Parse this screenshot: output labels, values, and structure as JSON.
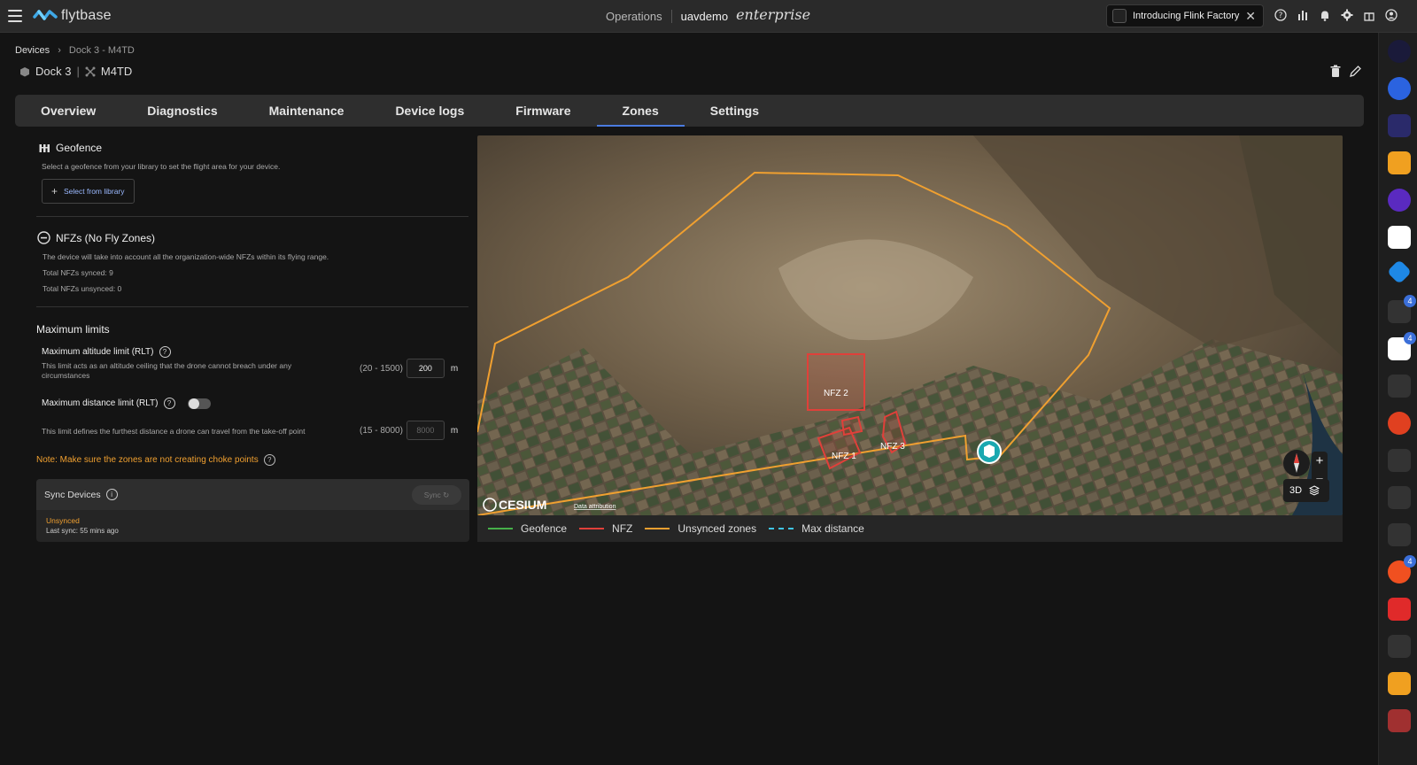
{
  "app": {
    "brand": "flytbase",
    "nav_operations": "Operations",
    "org": "uavdemo",
    "edition": "enterprise",
    "promo_text": "Introducing Flink Factory"
  },
  "breadcrumb": {
    "root": "Devices",
    "current": "Dock 3 - M4TD"
  },
  "device": {
    "dock": "Dock 3",
    "drone": "M4TD"
  },
  "tabs": [
    {
      "label": "Overview"
    },
    {
      "label": "Diagnostics"
    },
    {
      "label": "Maintenance"
    },
    {
      "label": "Device logs"
    },
    {
      "label": "Firmware"
    },
    {
      "label": "Zones",
      "active": true
    },
    {
      "label": "Settings"
    }
  ],
  "geofence": {
    "title": "Geofence",
    "desc": "Select a geofence from your library to set the flight area for your device.",
    "button": "Select from library"
  },
  "nfz": {
    "title": "NFZs (No Fly Zones)",
    "desc": "The device will take into account all the organization-wide NFZs within its flying range.",
    "synced": "Total NFZs synced: 9",
    "unsynced": "Total NFZs unsynced: 0"
  },
  "limits": {
    "title": "Maximum limits",
    "altitude": {
      "label": "Maximum altitude limit (RLT)",
      "desc": "This limit acts as an altitude ceiling that the drone cannot breach under any circumstances",
      "range": "(20 - 1500)",
      "value": "200",
      "unit": "m"
    },
    "distance": {
      "label": "Maximum distance limit (RLT)",
      "desc": "This limit defines the furthest distance a drone can travel from the take-off point",
      "range": "(15 - 8000)",
      "value": "8000",
      "unit": "m",
      "enabled": false
    },
    "note": "Note: Make sure the zones are not creating choke points"
  },
  "sync": {
    "title": "Sync Devices",
    "button": "Sync",
    "status": "Unsynced",
    "last_sync": "Last sync: 55 mins ago"
  },
  "map": {
    "zones": [
      "NFZ 2",
      "NFZ 1",
      "NFZ 3"
    ],
    "view_mode": "3D",
    "attribution_brand": "CESIUM",
    "attribution_link": "Data attribution"
  },
  "legend": [
    {
      "label": "Geofence",
      "color": "#46b04a",
      "style": "solid"
    },
    {
      "label": "NFZ",
      "color": "#e0403a",
      "style": "solid"
    },
    {
      "label": "Unsynced zones",
      "color": "#f0a030",
      "style": "solid"
    },
    {
      "label": "Max distance",
      "color": "#3fc5e6",
      "style": "dashed"
    }
  ],
  "rail_badges": [
    "4",
    "4",
    "4"
  ]
}
